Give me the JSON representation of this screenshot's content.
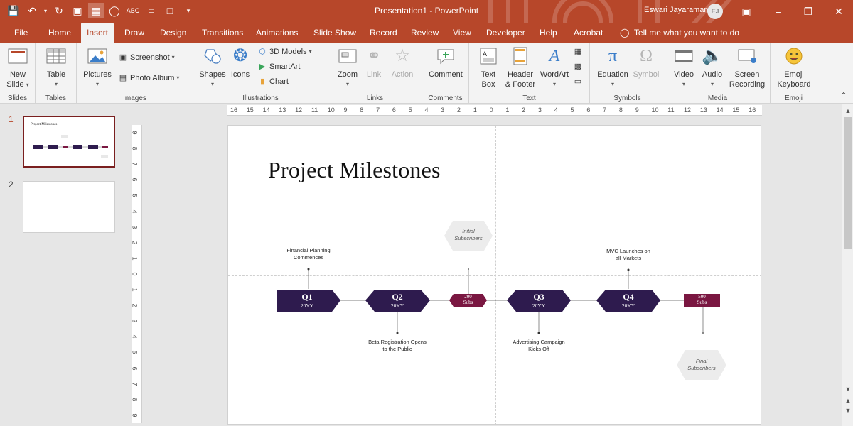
{
  "app": {
    "title": "Presentation1 - PowerPoint",
    "user_name": "Eswari Jayaraman",
    "user_initials": "EJ"
  },
  "tabs": [
    "File",
    "Home",
    "Insert",
    "Draw",
    "Design",
    "Transitions",
    "Animations",
    "Slide Show",
    "Record",
    "Review",
    "View",
    "Developer",
    "Help",
    "Acrobat"
  ],
  "active_tab": "Insert",
  "tell_me": "Tell me what you want to do",
  "ribbon": {
    "slides": {
      "label": "Slides",
      "new_slide_1": "New",
      "new_slide_2": "Slide"
    },
    "tables": {
      "label": "Tables",
      "table": "Table"
    },
    "images": {
      "label": "Images",
      "pictures": "Pictures",
      "screenshot": "Screenshot",
      "photo_album": "Photo Album"
    },
    "illustrations": {
      "label": "Illustrations",
      "shapes": "Shapes",
      "icons": "Icons",
      "models": "3D Models",
      "smartart": "SmartArt",
      "chart": "Chart"
    },
    "links": {
      "label": "Links",
      "zoom": "Zoom",
      "link": "Link",
      "action": "Action"
    },
    "comments": {
      "label": "Comments",
      "comment": "Comment"
    },
    "text": {
      "label": "Text",
      "textbox_1": "Text",
      "textbox_2": "Box",
      "header_1": "Header",
      "header_2": "& Footer",
      "wordart": "WordArt"
    },
    "symbols": {
      "label": "Symbols",
      "equation": "Equation",
      "symbol": "Symbol"
    },
    "media": {
      "label": "Media",
      "video": "Video",
      "audio": "Audio",
      "screen_1": "Screen",
      "screen_2": "Recording"
    },
    "emoji": {
      "label": "Emoji",
      "emoji_1": "Emoji",
      "emoji_2": "Keyboard"
    }
  },
  "slides_panel": {
    "numbers": [
      "1",
      "2"
    ],
    "thumb_title": "Project Milestones"
  },
  "ruler": {
    "h_labels": [
      "16",
      "15",
      "14",
      "13",
      "12",
      "11",
      "10",
      "9",
      "8",
      "7",
      "6",
      "5",
      "4",
      "3",
      "2",
      "1",
      "0",
      "1",
      "2",
      "3",
      "4",
      "5",
      "6",
      "7",
      "8",
      "9",
      "10",
      "11",
      "12",
      "13",
      "14",
      "15",
      "16"
    ],
    "v_labels": [
      "9",
      "8",
      "7",
      "6",
      "5",
      "4",
      "3",
      "2",
      "1",
      "0",
      "1",
      "2",
      "3",
      "4",
      "5",
      "6",
      "7",
      "8",
      "9"
    ]
  },
  "slide": {
    "title": "Project Milestones",
    "milestones": [
      {
        "q": "Q1",
        "year": "20YY"
      },
      {
        "q": "Q2",
        "year": "20YY"
      },
      {
        "q": "Q3",
        "year": "20YY"
      },
      {
        "q": "Q4",
        "year": "20YY"
      }
    ],
    "subs": [
      {
        "num": "200",
        "unit": "Subs"
      },
      {
        "num": "500",
        "unit": "Subs"
      }
    ],
    "labels": {
      "financial_1": "Financial Planning",
      "financial_2": "Commences",
      "beta_1": "Beta Registration Opens",
      "beta_2": "to the Public",
      "initial_1": "Initial",
      "initial_2": "Subscribers",
      "advert_1": "Advertising Campaign",
      "advert_2": "Kicks Off",
      "mvc_1": "MVC Launches on",
      "mvc_2": "all Markets",
      "final_1": "Final",
      "final_2": "Subscribers"
    }
  },
  "colors": {
    "accent": "#b7472a",
    "milestone": "#2e1b4e",
    "subs": "#7a1741"
  }
}
